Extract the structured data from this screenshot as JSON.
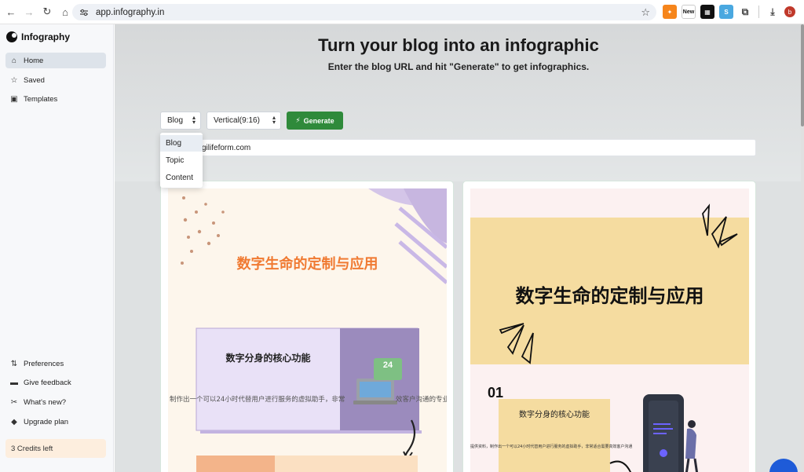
{
  "browser": {
    "url": "app.infography.in",
    "ext_new_label": "New",
    "profile_initial": "b"
  },
  "sidebar": {
    "app_name": "Infography",
    "nav": [
      {
        "label": "Home",
        "icon": "home-icon"
      },
      {
        "label": "Saved",
        "icon": "star-icon"
      },
      {
        "label": "Templates",
        "icon": "templates-icon"
      }
    ],
    "bottom": [
      {
        "label": "Preferences",
        "icon": "preferences-icon"
      },
      {
        "label": "Give feedback",
        "icon": "feedback-icon"
      },
      {
        "label": "What's new?",
        "icon": "whats-new-icon"
      },
      {
        "label": "Upgrade plan",
        "icon": "upgrade-icon"
      }
    ],
    "credits": "3 Credits left"
  },
  "main": {
    "headline": "Turn your blog into an infographic",
    "subline": "Enter the blog URL and hit \"Generate\" to get infographics.",
    "source_select": "Blog",
    "ratio_select": "Vertical(9:16)",
    "generate_label": "Generate",
    "url_value": "gilifeform.com",
    "dropdown_options": [
      "Blog",
      "Topic",
      "Content"
    ]
  },
  "cards": [
    {
      "title": "数字生命的定制与应用",
      "section_title": "数字分身的核心功能",
      "body": "制作出一个可以24小时代替用户进行服务的虚拟助手，非常",
      "body_tail": "效客户沟通的专业",
      "badge": "24"
    },
    {
      "title": "数字生命的定制与应用",
      "number": "01",
      "section_title": "数字分身的核心功能",
      "body": "提供资料，制作出一个可以24小时代替用户进行服务的虚拟助手，非常适合需要高效客户沟通"
    }
  ],
  "colors": {
    "accent_green": "#2f8a3b",
    "active_nav": "#dde3ea",
    "credits_bg": "#fdeede",
    "card1_title": "#f07a32",
    "card2_banner": "#f5dca0"
  }
}
